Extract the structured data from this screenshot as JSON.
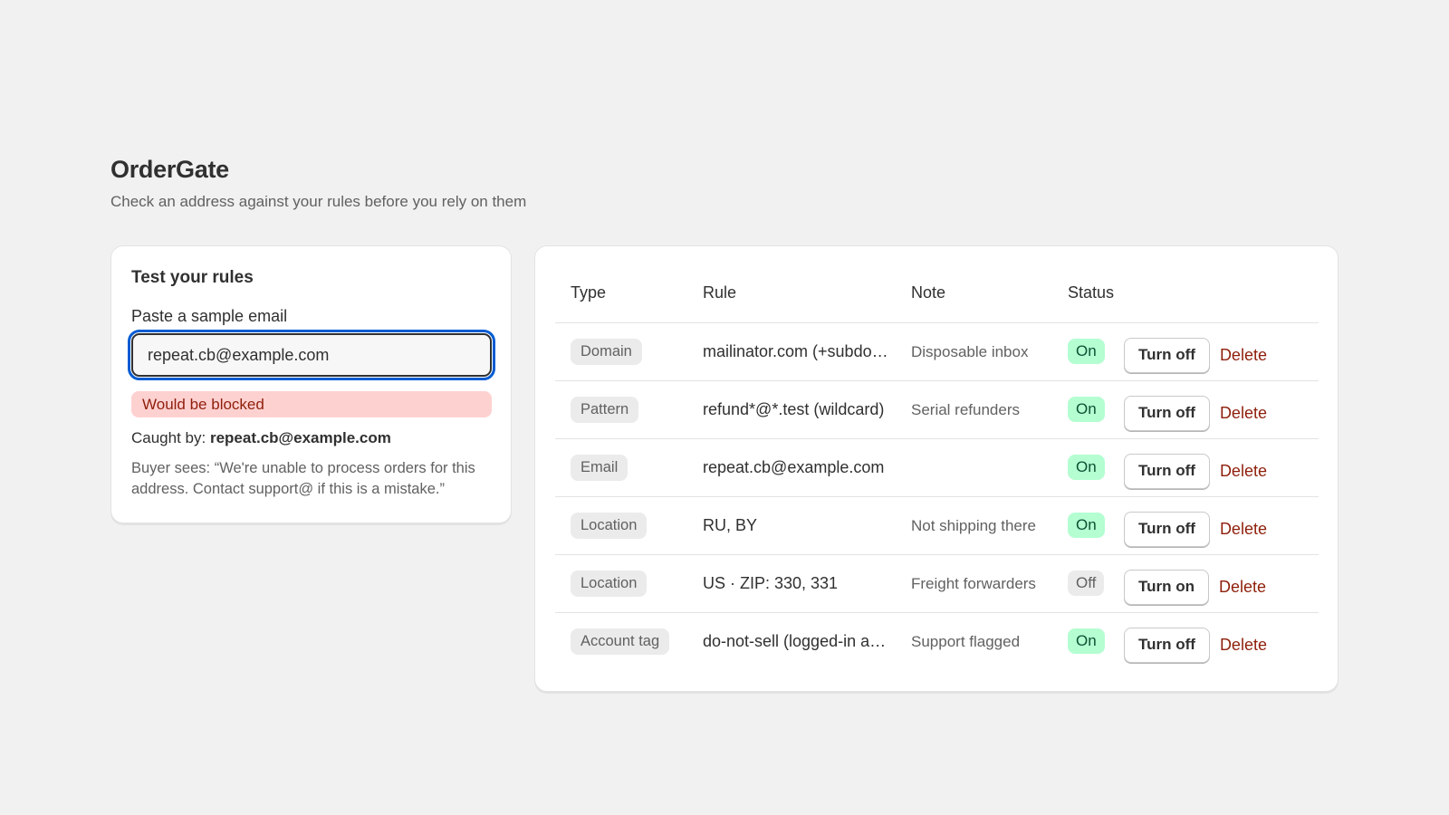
{
  "app": {
    "title": "OrderGate",
    "subtitle": "Check an address against your rules before you rely on them"
  },
  "tester": {
    "heading": "Test your rules",
    "field_label": "Paste a sample email",
    "input_value": "repeat.cb@example.com",
    "result": "Would be blocked",
    "caught_prefix": "Caught by: ",
    "caught_value": "repeat.cb@example.com",
    "buyer_message": "Buyer sees: “We're unable to process orders for this address. Contact support@ if this is a mistake.”"
  },
  "rules": {
    "columns": [
      "Type",
      "Rule",
      "Note",
      "Status"
    ],
    "rows": [
      {
        "type": "Domain",
        "rule": "mailinator.com (+subdomains)",
        "note": "Disposable inbox",
        "status": "On",
        "toggle": "Turn off",
        "delete": "Delete"
      },
      {
        "type": "Pattern",
        "rule": "refund*@*.test (wildcard)",
        "note": "Serial refunders",
        "status": "On",
        "toggle": "Turn off",
        "delete": "Delete"
      },
      {
        "type": "Email",
        "rule": "repeat.cb@example.com",
        "note": "",
        "status": "On",
        "toggle": "Turn off",
        "delete": "Delete"
      },
      {
        "type": "Location",
        "rule": "RU, BY",
        "note": "Not shipping there",
        "status": "On",
        "toggle": "Turn off",
        "delete": "Delete"
      },
      {
        "type": "Location",
        "rule": "US · ZIP: 330, 331",
        "note": "Freight forwarders",
        "status": "Off",
        "toggle": "Turn on",
        "delete": "Delete"
      },
      {
        "type": "Account tag",
        "rule": "do-not-sell (logged-in accounts)",
        "note": "Support flagged",
        "status": "On",
        "toggle": "Turn off",
        "delete": "Delete"
      }
    ]
  },
  "colors": {
    "status_on_bg": "#b4fed2",
    "status_off_bg": "#ebebeb",
    "blocked_bg": "#fed1d1",
    "danger": "#8e1f0b",
    "focus": "#005bd3"
  }
}
